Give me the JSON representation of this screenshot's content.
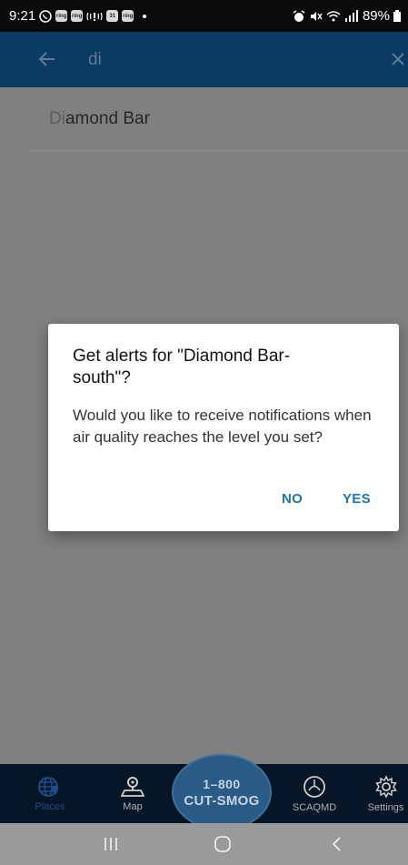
{
  "status_bar": {
    "time": "9:21",
    "notification_icons": [
      "ring",
      "ring",
      "31",
      "ring"
    ],
    "battery": "89%"
  },
  "search": {
    "query": "di"
  },
  "results": [
    {
      "match": "Di",
      "rest": "amond Bar"
    }
  ],
  "dialog": {
    "title": "Get alerts for \"Diamond Bar-south\"?",
    "message": "Would you like to receive notifications when air quality reaches the level you set?",
    "no_label": "NO",
    "yes_label": "YES"
  },
  "bottom_nav": {
    "places_label": "Places",
    "map_label": "Map",
    "call_line1": "1–800",
    "call_line2": "CUT-SMOG",
    "scaqmd_label": "SCAQMD",
    "settings_label": "Settings",
    "active": "places"
  },
  "colors": {
    "app_bar": "#0b3b62",
    "accent": "#1a78b0",
    "scrim": "#808080"
  }
}
